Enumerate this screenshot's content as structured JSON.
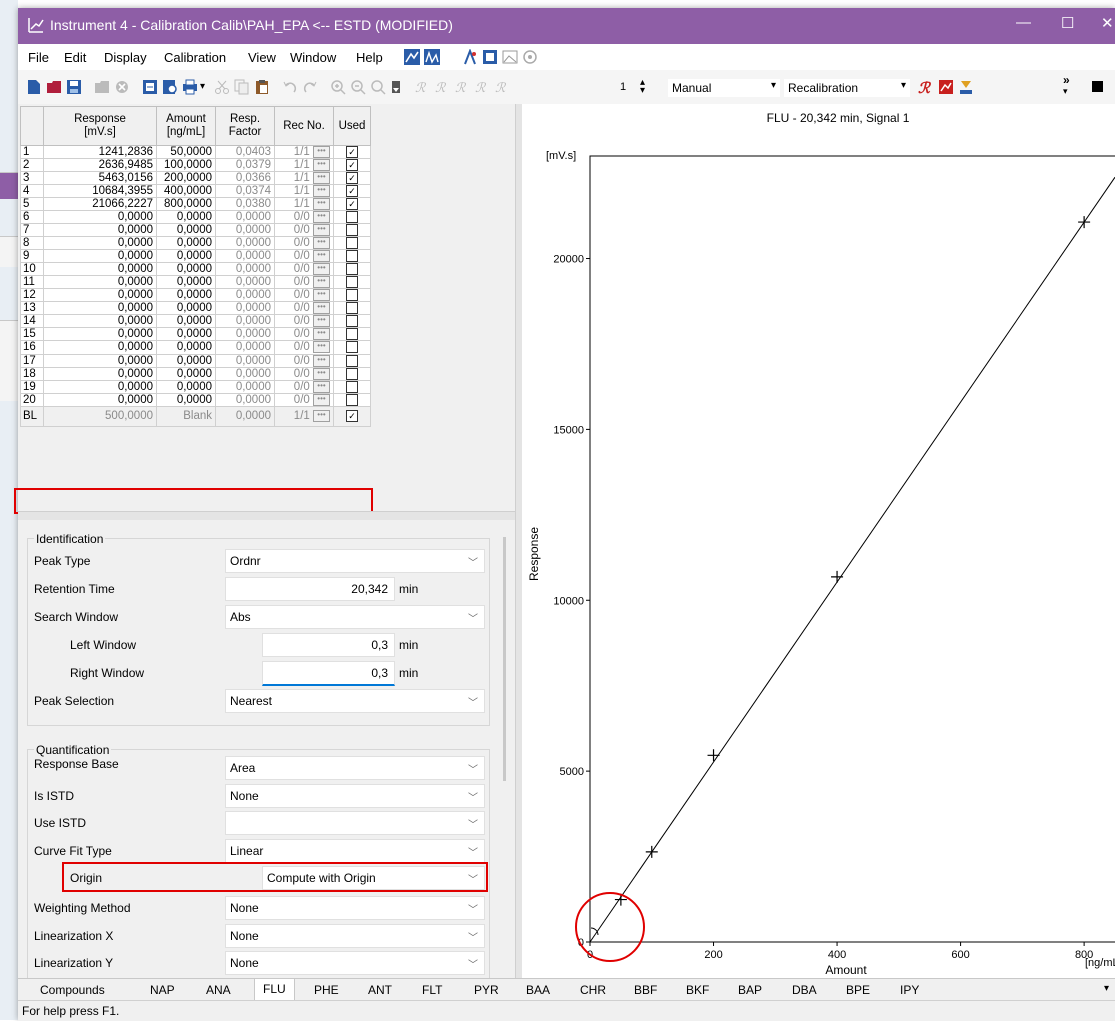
{
  "window": {
    "title": "Instrument 4 - Calibration Calib\\PAH_EPA <-- ESTD (MODIFIED)",
    "controls": [
      "—",
      "☐",
      "✕"
    ]
  },
  "menu": [
    "File",
    "Edit",
    "Display",
    "Calibration",
    "View",
    "Window",
    "Help"
  ],
  "toolbar": {
    "level_value": "1",
    "mode_value": "Manual",
    "recal_value": "Recalibration"
  },
  "table": {
    "headers": [
      "",
      "Response\n[mV.s]",
      "Amount\n[ng/mL]",
      "Resp.\nFactor",
      "Rec No.",
      "Used"
    ],
    "rows": [
      {
        "n": "1",
        "response": "1241,2836",
        "amount": "50,0000",
        "rf": "0,0403",
        "rec": "1/1",
        "used": true
      },
      {
        "n": "2",
        "response": "2636,9485",
        "amount": "100,0000",
        "rf": "0,0379",
        "rec": "1/1",
        "used": true
      },
      {
        "n": "3",
        "response": "5463,0156",
        "amount": "200,0000",
        "rf": "0,0366",
        "rec": "1/1",
        "used": true
      },
      {
        "n": "4",
        "response": "10684,3955",
        "amount": "400,0000",
        "rf": "0,0374",
        "rec": "1/1",
        "used": true
      },
      {
        "n": "5",
        "response": "21066,2227",
        "amount": "800,0000",
        "rf": "0,0380",
        "rec": "1/1",
        "used": true
      },
      {
        "n": "6",
        "response": "0,0000",
        "amount": "0,0000",
        "rf": "0,0000",
        "rec": "0/0",
        "used": false
      },
      {
        "n": "7",
        "response": "0,0000",
        "amount": "0,0000",
        "rf": "0,0000",
        "rec": "0/0",
        "used": false
      },
      {
        "n": "8",
        "response": "0,0000",
        "amount": "0,0000",
        "rf": "0,0000",
        "rec": "0/0",
        "used": false
      },
      {
        "n": "9",
        "response": "0,0000",
        "amount": "0,0000",
        "rf": "0,0000",
        "rec": "0/0",
        "used": false
      },
      {
        "n": "10",
        "response": "0,0000",
        "amount": "0,0000",
        "rf": "0,0000",
        "rec": "0/0",
        "used": false
      },
      {
        "n": "11",
        "response": "0,0000",
        "amount": "0,0000",
        "rf": "0,0000",
        "rec": "0/0",
        "used": false
      },
      {
        "n": "12",
        "response": "0,0000",
        "amount": "0,0000",
        "rf": "0,0000",
        "rec": "0/0",
        "used": false
      },
      {
        "n": "13",
        "response": "0,0000",
        "amount": "0,0000",
        "rf": "0,0000",
        "rec": "0/0",
        "used": false
      },
      {
        "n": "14",
        "response": "0,0000",
        "amount": "0,0000",
        "rf": "0,0000",
        "rec": "0/0",
        "used": false
      },
      {
        "n": "15",
        "response": "0,0000",
        "amount": "0,0000",
        "rf": "0,0000",
        "rec": "0/0",
        "used": false
      },
      {
        "n": "16",
        "response": "0,0000",
        "amount": "0,0000",
        "rf": "0,0000",
        "rec": "0/0",
        "used": false
      },
      {
        "n": "17",
        "response": "0,0000",
        "amount": "0,0000",
        "rf": "0,0000",
        "rec": "0/0",
        "used": false
      },
      {
        "n": "18",
        "response": "0,0000",
        "amount": "0,0000",
        "rf": "0,0000",
        "rec": "0/0",
        "used": false
      },
      {
        "n": "19",
        "response": "0,0000",
        "amount": "0,0000",
        "rf": "0,0000",
        "rec": "0/0",
        "used": false
      },
      {
        "n": "20",
        "response": "0,0000",
        "amount": "0,0000",
        "rf": "0,0000",
        "rec": "0/0",
        "used": false
      }
    ],
    "blank_row": {
      "n": "BL",
      "response": "500,0000",
      "amount": "Blank",
      "rf": "0,0000",
      "rec": "1/1",
      "used": true
    }
  },
  "identification": {
    "group_label": "Identification",
    "peak_type_label": "Peak Type",
    "peak_type_value": "Ordnr",
    "retention_time_label": "Retention Time",
    "retention_time_value": "20,342",
    "retention_time_unit": "min",
    "search_window_label": "Search Window",
    "search_window_value": "Abs",
    "left_window_label": "Left Window",
    "left_window_value": "0,3",
    "left_window_unit": "min",
    "right_window_label": "Right Window",
    "right_window_value": "0,3",
    "right_window_unit": "min",
    "peak_selection_label": "Peak Selection",
    "peak_selection_value": "Nearest"
  },
  "quantification": {
    "group_label": "Quantification",
    "response_base_label": "Response Base",
    "response_base_value": "Area",
    "is_istd_label": "Is ISTD",
    "is_istd_value": "None",
    "use_istd_label": "Use ISTD",
    "use_istd_value": "",
    "curve_fit_label": "Curve Fit Type",
    "curve_fit_value": "Linear",
    "origin_label": "Origin",
    "origin_value": "Compute with Origin",
    "weighting_label": "Weighting Method",
    "weighting_value": "None",
    "lin_x_label": "Linearization X",
    "lin_x_value": "None",
    "lin_y_label": "Linearization Y",
    "lin_y_value": "None"
  },
  "tabs": [
    "Compounds",
    "NAP",
    "ANA",
    "FLU",
    "PHE",
    "ANT",
    "FLT",
    "PYR",
    "BAA",
    "CHR",
    "BBF",
    "BKF",
    "BAP",
    "DBA",
    "BPE",
    "IPY"
  ],
  "active_tab": "FLU",
  "status": "For help press F1.",
  "colors": {
    "titlebar": "#8e5ea6",
    "highlight": "#e00000",
    "accent_field": "#0078d7"
  },
  "chart_data": {
    "type": "scatter",
    "title": "FLU - 20,342 min, Signal 1",
    "xlabel": "Amount",
    "xunit": "[ng/mL]",
    "ylabel": "Response",
    "yunit": "[mV.s]",
    "xlim": [
      0,
      850
    ],
    "ylim": [
      0,
      23000
    ],
    "xticks": [
      0,
      200,
      400,
      600,
      800
    ],
    "yticks": [
      0,
      5000,
      10000,
      15000,
      20000
    ],
    "points": [
      {
        "x": 50,
        "y": 1241.2836
      },
      {
        "x": 100,
        "y": 2636.9485
      },
      {
        "x": 200,
        "y": 5463.0156
      },
      {
        "x": 400,
        "y": 10684.3955
      },
      {
        "x": 800,
        "y": 21066.2227
      }
    ],
    "fit_line": {
      "x": [
        0,
        850
      ],
      "y": [
        0,
        22380
      ]
    },
    "marker": "+",
    "grid": false
  }
}
